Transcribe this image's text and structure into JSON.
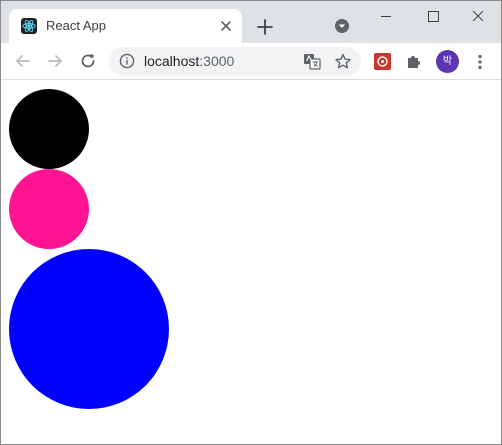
{
  "browser": {
    "tab": {
      "title": "React App",
      "favicon": "react-logo-icon"
    },
    "address_bar": {
      "host": "localhost",
      "port": ":3000"
    },
    "profile_avatar_text": "박",
    "icons": [
      "back-arrow-icon",
      "forward-arrow-icon",
      "reload-icon",
      "info-icon",
      "translate-icon",
      "star-icon",
      "extension-icon",
      "puzzle-icon",
      "menu-icon"
    ]
  },
  "page": {
    "circles": [
      {
        "color": "#000000"
      },
      {
        "color": "#ff1493"
      },
      {
        "color": "#0000ff"
      }
    ]
  },
  "colors": {
    "tabstrip": "#dee1e6",
    "omnibox": "#f1f3f4",
    "avatar": "#5e35b1"
  }
}
